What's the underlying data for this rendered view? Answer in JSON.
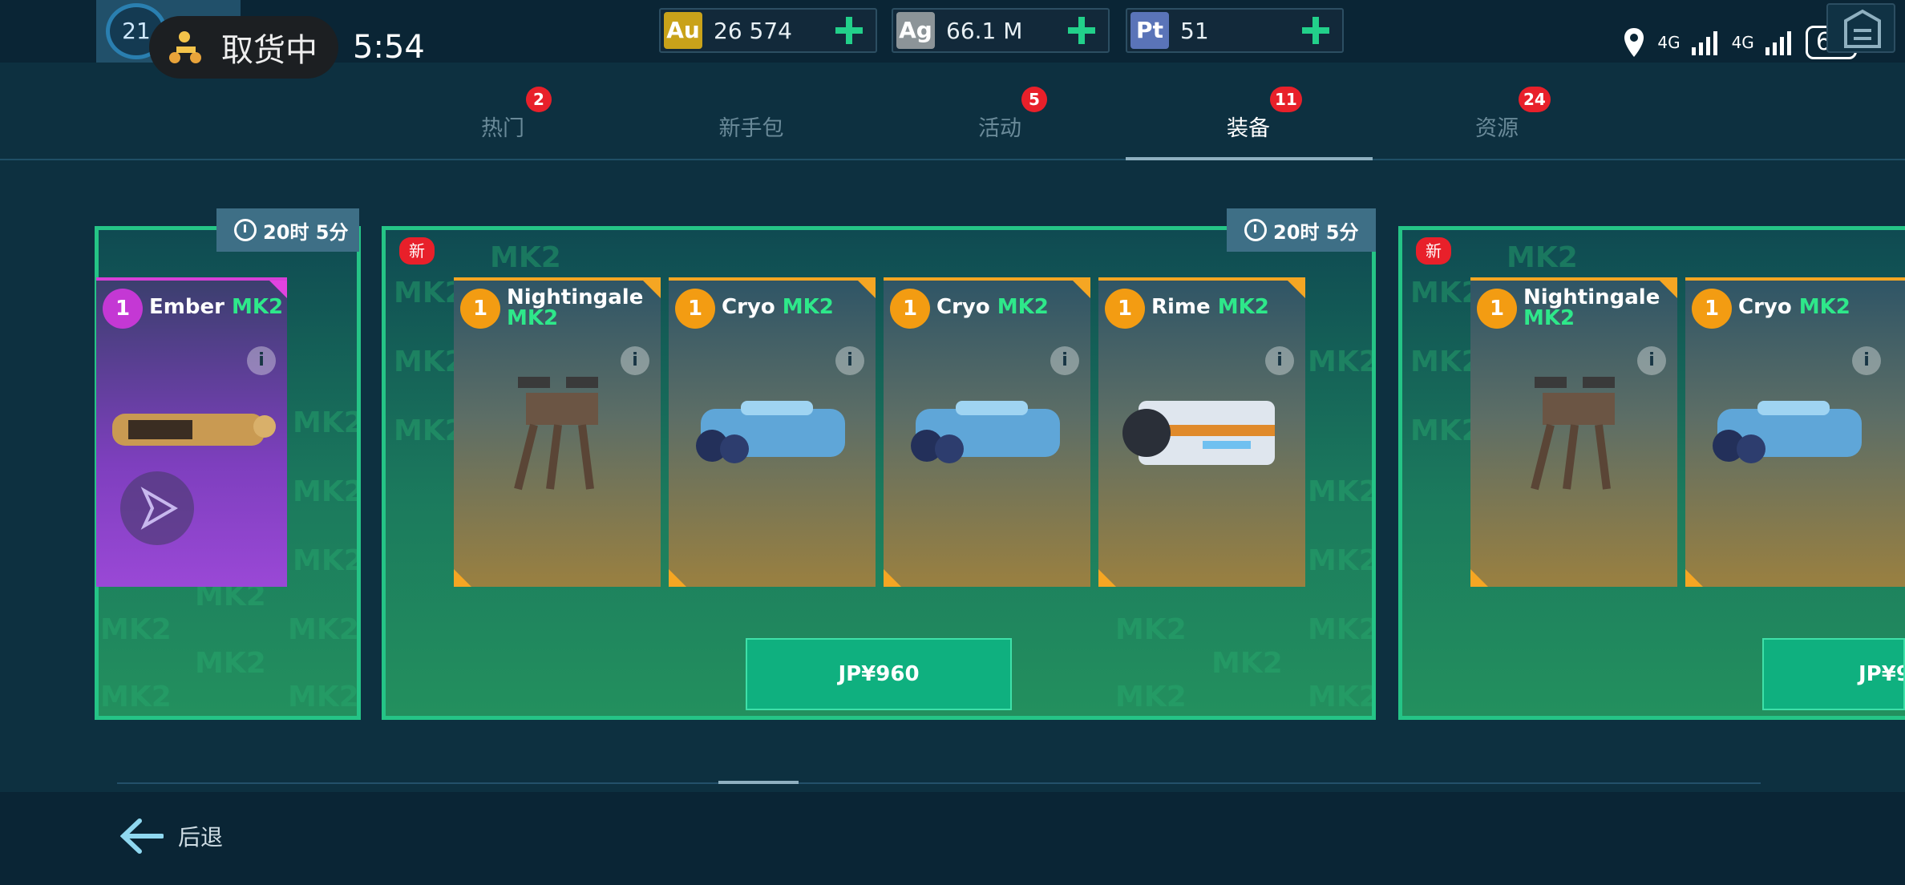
{
  "status": {
    "level": "21",
    "delivery_label": "取货中",
    "time": "5:54",
    "net1": "4G",
    "net2": "4G",
    "battery": "66"
  },
  "currencies": [
    {
      "code": "Au",
      "value": "26 574",
      "color": "#c9a21a"
    },
    {
      "code": "Ag",
      "value": "66.1 M",
      "color": "#8c9498"
    },
    {
      "code": "Pt",
      "value": "51",
      "color": "#5a74b8"
    }
  ],
  "tabs": [
    {
      "label": "热门",
      "badge": "2"
    },
    {
      "label": "新手包",
      "badge": ""
    },
    {
      "label": "活动",
      "badge": "5"
    },
    {
      "label": "装备",
      "badge": "11",
      "active": true
    },
    {
      "label": "资源",
      "badge": "24"
    }
  ],
  "offers": [
    {
      "timer": "20时 5分",
      "cards": [
        {
          "count": "1",
          "name": "Ember",
          "mk": "MK2"
        }
      ]
    },
    {
      "timer": "20时 5分",
      "new_badge": "新",
      "price": "JP¥960",
      "cards": [
        {
          "count": "1",
          "name": "Nightingale",
          "mk": "MK2"
        },
        {
          "count": "1",
          "name": "Cryo",
          "mk": "MK2"
        },
        {
          "count": "1",
          "name": "Cryo",
          "mk": "MK2"
        },
        {
          "count": "1",
          "name": "Rime",
          "mk": "MK2"
        }
      ]
    },
    {
      "new_badge": "新",
      "price": "JP¥9",
      "cards": [
        {
          "count": "1",
          "name": "Nightingale",
          "mk": "MK2"
        },
        {
          "count": "1",
          "name": "Cryo",
          "mk": "MK2"
        }
      ]
    }
  ],
  "watermark": "MK2",
  "info_glyph": "i",
  "footer": {
    "back_label": "后退"
  }
}
